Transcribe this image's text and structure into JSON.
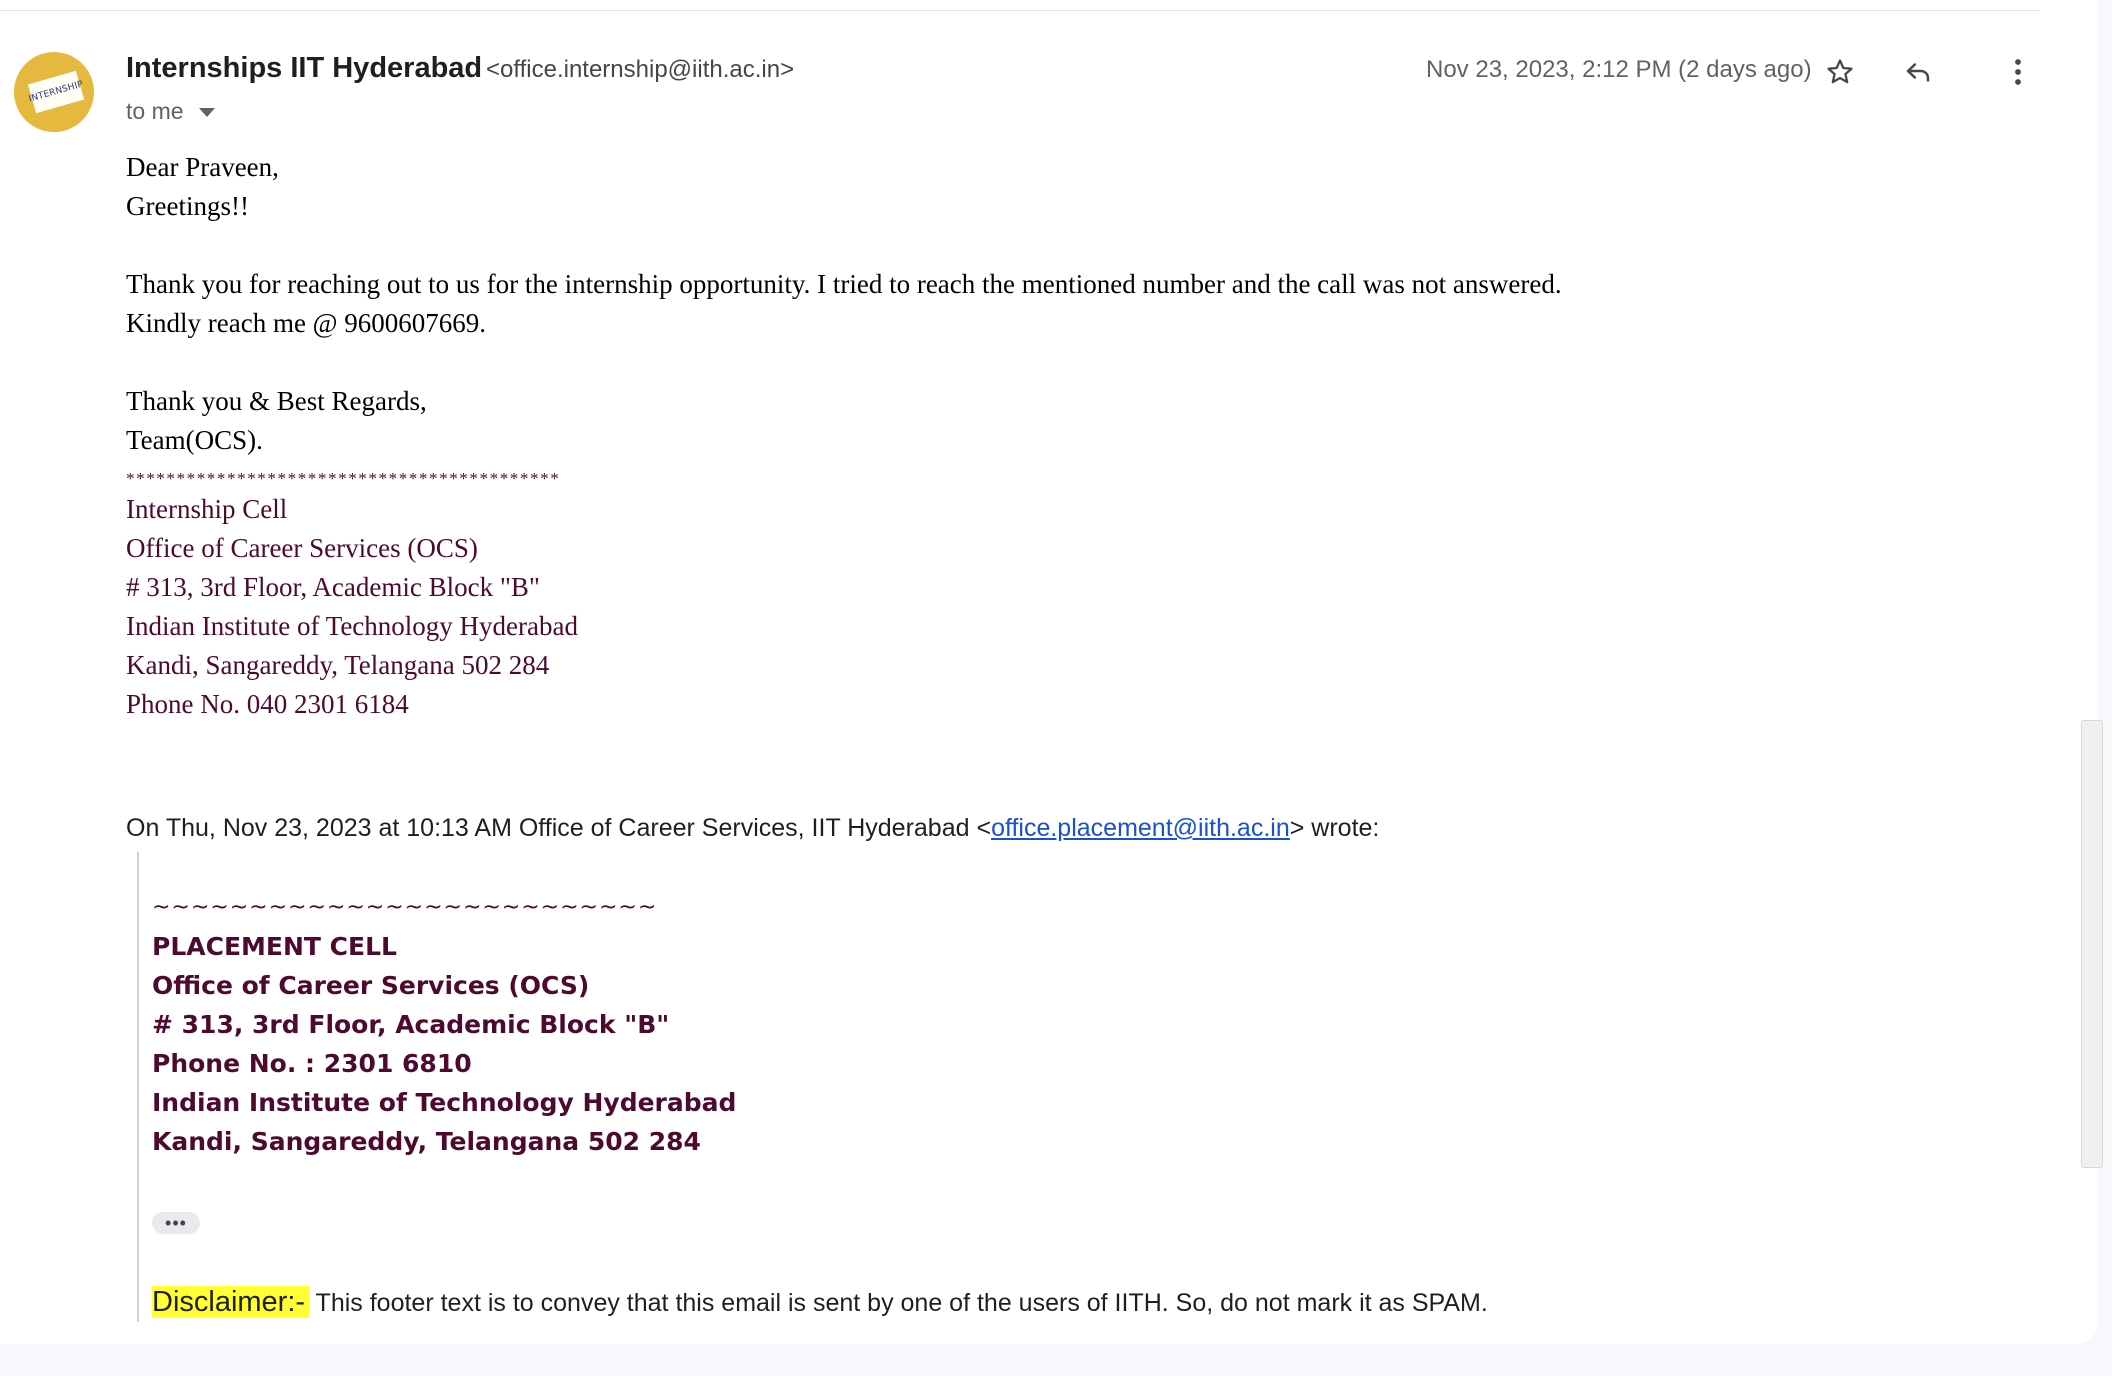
{
  "header": {
    "sender_name": "Internships IIT Hyderabad",
    "sender_email": "<office.internship@iith.ac.in>",
    "to": "to me",
    "date": "Nov 23, 2023, 2:12 PM (2 days ago)",
    "avatar_text": "INTERNSHIP",
    "icons": [
      "star-icon",
      "reply-icon",
      "more-vert-icon"
    ]
  },
  "message": {
    "greeting1": "Dear Praveen,",
    "greeting2": "Greetings!!",
    "para1": "Thank you for reaching out to us for the internship opportunity. I tried to reach the mentioned number and the call was not answered.",
    "para2": "Kindly reach me @ 9600607669.",
    "closing1": "Thank you & Best Regards,",
    "closing2": "Team(OCS).",
    "stars": "*******************************************",
    "signature": [
      "Internship Cell",
      "Office of Career Services (OCS)",
      "# 313, 3rd Floor, Academic Block \"B\"",
      "Indian Institute of Technology Hyderabad",
      "Kandi, Sangareddy, Telangana 502 284",
      "Phone No. 040 2301 6184"
    ]
  },
  "quoted": {
    "wrote_prefix": "On Thu, Nov 23, 2023 at 10:13 AM Office of Career Services, IIT Hyderabad <",
    "wrote_email": "office.placement@iith.ac.in",
    "wrote_suffix": "> wrote:",
    "tilde": "~~~~~~~~~~~~~~~~~~~~~~~~~~",
    "lines": [
      "PLACEMENT CELL",
      "Office of Career Services (OCS)",
      "# 313, 3rd Floor, Academic Block \"B\"",
      "Phone No. : 2301 6810",
      "Indian Institute of Technology Hyderabad",
      "Kandi, Sangareddy, Telangana 502 284"
    ],
    "show_trimmed": "•••",
    "disclaimer_label": "Disclaimer:-",
    "disclaimer_text": " This footer text is to convey that this email is sent by one of the users of IITH. So, do not mark it as SPAM."
  },
  "colors": {
    "signature": "#4d0a2e",
    "link": "#1a4fd6",
    "highlight": "#ffff33"
  }
}
